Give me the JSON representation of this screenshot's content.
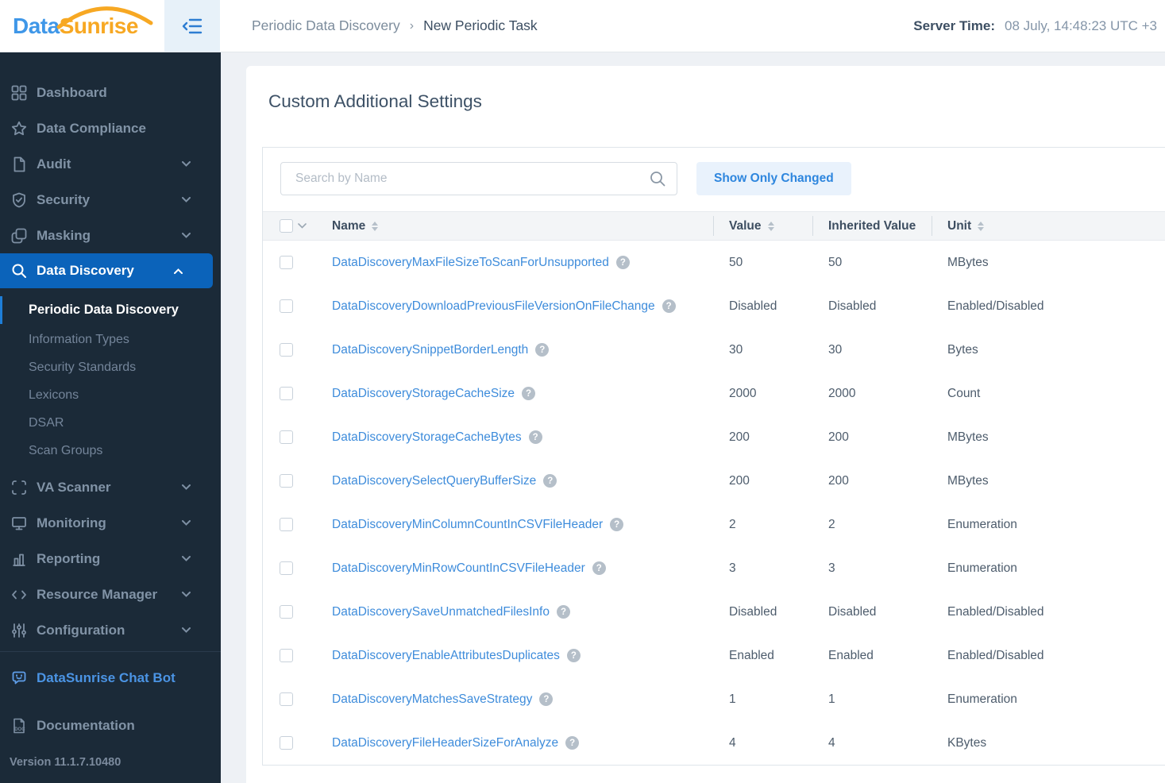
{
  "logo": {
    "part1": "Data",
    "part2": "Sunrise"
  },
  "topbar": {
    "breadcrumb": {
      "parent": "Periodic Data Discovery",
      "separator": "›",
      "current": "New Periodic Task"
    },
    "server_time_label": "Server Time:",
    "server_time_value": "08 July, 14:48:23  UTC +3"
  },
  "sidebar": {
    "items": [
      {
        "label": "Dashboard",
        "icon": "grid-icon",
        "chevron": false
      },
      {
        "label": "Data Compliance",
        "icon": "star-icon",
        "chevron": false
      },
      {
        "label": "Audit",
        "icon": "document-icon",
        "chevron": true
      },
      {
        "label": "Security",
        "icon": "shield-check-icon",
        "chevron": true
      },
      {
        "label": "Masking",
        "icon": "copy-icon",
        "chevron": true
      },
      {
        "label": "Data Discovery",
        "icon": "magnifier-icon",
        "chevron": "up",
        "active": true
      }
    ],
    "subitems": [
      {
        "label": "Periodic Data Discovery",
        "active": true
      },
      {
        "label": "Information Types",
        "active": false
      },
      {
        "label": "Security Standards",
        "active": false
      },
      {
        "label": "Lexicons",
        "active": false
      },
      {
        "label": "DSAR",
        "active": false
      },
      {
        "label": "Scan Groups",
        "active": false
      }
    ],
    "items_lower": [
      {
        "label": "VA Scanner",
        "icon": "scan-frame-icon",
        "chevron": true
      },
      {
        "label": "Monitoring",
        "icon": "monitor-icon",
        "chevron": true
      },
      {
        "label": "Reporting",
        "icon": "bar-chart-icon",
        "chevron": true
      },
      {
        "label": "Resource Manager",
        "icon": "code-icon",
        "chevron": true
      },
      {
        "label": "Configuration",
        "icon": "sliders-icon",
        "chevron": true
      }
    ],
    "chatbot_label": "DataSunrise Chat Bot",
    "documentation_label": "Documentation",
    "version": "Version 11.1.7.10480"
  },
  "main": {
    "title": "Custom Additional Settings",
    "search_placeholder": "Search by Name",
    "show_only_changed_label": "Show Only Changed",
    "table": {
      "columns": [
        "Name",
        "Value",
        "Inherited Value",
        "Unit"
      ],
      "sortable_columns": [
        "Name",
        "Value",
        "Unit"
      ],
      "rows": [
        {
          "name": "DataDiscoveryMaxFileSizeToScanForUnsupported",
          "value": "50",
          "inherited": "50",
          "unit": "MBytes"
        },
        {
          "name": "DataDiscoveryDownloadPreviousFileVersionOnFileChange",
          "value": "Disabled",
          "inherited": "Disabled",
          "unit": "Enabled/Disabled"
        },
        {
          "name": "DataDiscoverySnippetBorderLength",
          "value": "30",
          "inherited": "30",
          "unit": "Bytes"
        },
        {
          "name": "DataDiscoveryStorageCacheSize",
          "value": "2000",
          "inherited": "2000",
          "unit": "Count"
        },
        {
          "name": "DataDiscoveryStorageCacheBytes",
          "value": "200",
          "inherited": "200",
          "unit": "MBytes"
        },
        {
          "name": "DataDiscoverySelectQueryBufferSize",
          "value": "200",
          "inherited": "200",
          "unit": "MBytes"
        },
        {
          "name": "DataDiscoveryMinColumnCountInCSVFileHeader",
          "value": "2",
          "inherited": "2",
          "unit": "Enumeration"
        },
        {
          "name": "DataDiscoveryMinRowCountInCSVFileHeader",
          "value": "3",
          "inherited": "3",
          "unit": "Enumeration"
        },
        {
          "name": "DataDiscoverySaveUnmatchedFilesInfo",
          "value": "Disabled",
          "inherited": "Disabled",
          "unit": "Enabled/Disabled"
        },
        {
          "name": "DataDiscoveryEnableAttributesDuplicates",
          "value": "Enabled",
          "inherited": "Enabled",
          "unit": "Enabled/Disabled"
        },
        {
          "name": "DataDiscoveryMatchesSaveStrategy",
          "value": "1",
          "inherited": "1",
          "unit": "Enumeration"
        },
        {
          "name": "DataDiscoveryFileHeaderSizeForAnalyze",
          "value": "4",
          "inherited": "4",
          "unit": "KBytes"
        }
      ],
      "help_icon_glyph": "?"
    }
  },
  "colors": {
    "sidebar_bg": "#1b2a38",
    "active_nav_bg": "#0b63ba",
    "active_subitem_bar": "#1e7ed8",
    "link_blue": "#3e8cdb",
    "logo_blue": "#3f97e8",
    "logo_orange": "#f7a823",
    "button_bg": "#e9f2fc",
    "button_text": "#2e86de",
    "table_header_bg": "#f3f5f7"
  }
}
